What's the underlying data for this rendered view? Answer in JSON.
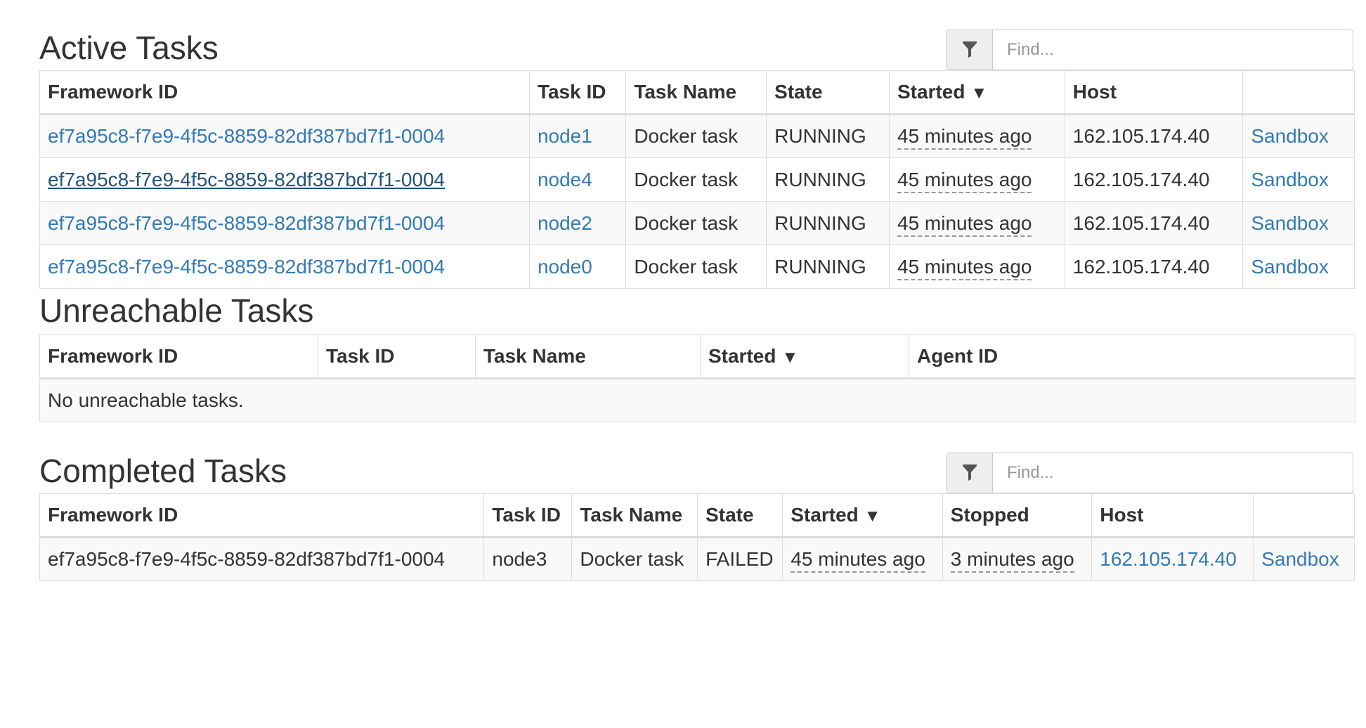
{
  "active": {
    "title": "Active Tasks",
    "filter_placeholder": "Find...",
    "filter_icon": "filter-icon",
    "columns": [
      "Framework ID",
      "Task ID",
      "Task Name",
      "State",
      "Started",
      "Host",
      ""
    ],
    "sort_indicator": "▼",
    "rows": [
      {
        "framework_id": "ef7a95c8-f7e9-4f5c-8859-82df387bd7f1-0004",
        "task_id": "node1",
        "task_name": "Docker task",
        "state": "RUNNING",
        "started": "45 minutes ago",
        "host": "162.105.174.40",
        "sandbox": "Sandbox"
      },
      {
        "framework_id": "ef7a95c8-f7e9-4f5c-8859-82df387bd7f1-0004",
        "task_id": "node4",
        "task_name": "Docker task",
        "state": "RUNNING",
        "started": "45 minutes ago",
        "host": "162.105.174.40",
        "sandbox": "Sandbox"
      },
      {
        "framework_id": "ef7a95c8-f7e9-4f5c-8859-82df387bd7f1-0004",
        "task_id": "node2",
        "task_name": "Docker task",
        "state": "RUNNING",
        "started": "45 minutes ago",
        "host": "162.105.174.40",
        "sandbox": "Sandbox"
      },
      {
        "framework_id": "ef7a95c8-f7e9-4f5c-8859-82df387bd7f1-0004",
        "task_id": "node0",
        "task_name": "Docker task",
        "state": "RUNNING",
        "started": "45 minutes ago",
        "host": "162.105.174.40",
        "sandbox": "Sandbox"
      }
    ]
  },
  "unreachable": {
    "title": "Unreachable Tasks",
    "columns": [
      "Framework ID",
      "Task ID",
      "Task Name",
      "Started",
      "Agent ID"
    ],
    "sort_indicator": "▼",
    "empty_message": "No unreachable tasks."
  },
  "completed": {
    "title": "Completed Tasks",
    "filter_placeholder": "Find...",
    "filter_icon": "filter-icon",
    "columns": [
      "Framework ID",
      "Task ID",
      "Task Name",
      "State",
      "Started",
      "Stopped",
      "Host",
      ""
    ],
    "sort_indicator": "▼",
    "rows": [
      {
        "framework_id": "ef7a95c8-f7e9-4f5c-8859-82df387bd7f1-0004",
        "task_id": "node3",
        "task_name": "Docker task",
        "state": "FAILED",
        "started": "45 minutes ago",
        "stopped": "3 minutes ago",
        "host": "162.105.174.40",
        "sandbox": "Sandbox"
      }
    ]
  },
  "colors": {
    "link": "#337ab7",
    "link_hover": "#23527c",
    "text": "#333333",
    "border": "#dddddd",
    "stripe": "#f9f9f9"
  }
}
